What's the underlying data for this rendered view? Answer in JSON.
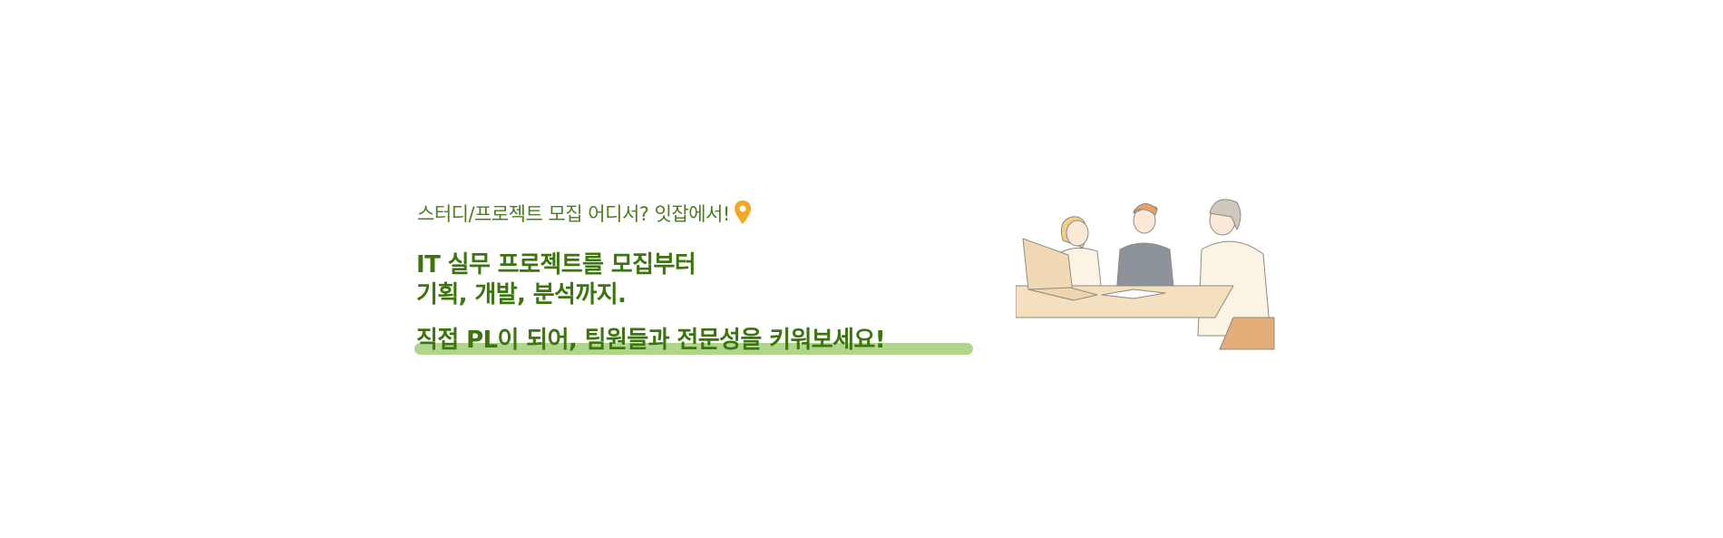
{
  "banner": {
    "subtitle": "스터디/프로젝트 모집 어디서? 잇잡에서!",
    "heading_line1": "IT 실무 프로젝트를 모집부터",
    "heading_line2": "기획, 개발, 분석까지.",
    "highlight": "직접 PL이 되어, 팀원들과 전문성을 키워보세요!",
    "pin_icon": "location-pin-icon",
    "colors": {
      "text": "#3b750e",
      "highlight": "#b1d68b",
      "pin": "#f5a623"
    }
  }
}
